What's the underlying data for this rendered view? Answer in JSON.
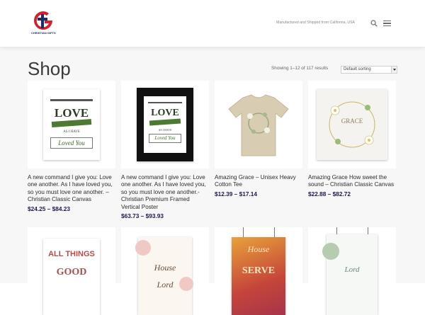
{
  "brand": {
    "logo_text": "CHRISTIAN GIFTS",
    "accent": "#d3202a",
    "navy": "#1f2a6b"
  },
  "header": {
    "tagline": "Manufactured and Shipped from California, USA"
  },
  "icons": {
    "search": "search-icon",
    "menu": "hamburger-menu-icon"
  },
  "shop": {
    "title": "Shop",
    "result_count": "Showing 1–12 of 117 results",
    "sort_selected": "Default sorting"
  },
  "products": [
    {
      "name": "A new command I give you: Love one another. As I have loved you, so you must love one another. – Christian Classic Canvas",
      "price": "$24.25 – $84.23"
    },
    {
      "name": "A new command I give you: Love one another. As I have loved you, so you must love one another.- Christian Premium Framed Vertical Poster",
      "price": "$63.73 – $93.93"
    },
    {
      "name": "Amazing Grace – Unisex Heavy Cotton Tee",
      "price": "$12.39 – $17.14"
    },
    {
      "name": "Amazing Grace How sweet the sound – Christian Classic Canvas",
      "price": "$22.88 – $82.72"
    }
  ],
  "artwork_text": {
    "love": "LOVE",
    "loved_you": "Loved You",
    "as_i_have": "AS I HAVE",
    "grace": "GRACE",
    "all_things": "ALL THINGS",
    "good": "GOOD",
    "house": "House",
    "serve": "SERVE",
    "lord": "Lord"
  }
}
